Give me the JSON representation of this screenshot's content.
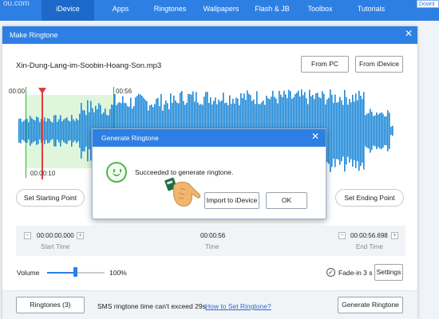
{
  "topnav": {
    "brand_fragment": "ou.com",
    "tabs": [
      {
        "label": "iDevice",
        "active": true
      },
      {
        "label": "Apps",
        "active": false
      },
      {
        "label": "Ringtones",
        "active": false
      },
      {
        "label": "Wallpapers",
        "active": false
      },
      {
        "label": "Flash & JB",
        "active": false
      },
      {
        "label": "Toolbox",
        "active": false
      },
      {
        "label": "Tutorials",
        "active": false
      }
    ],
    "download_label": "Downl",
    "accent_color": "#2d7fe3"
  },
  "window": {
    "title": "Make Ringtone",
    "close_icon": "close-icon",
    "file_name": "Xin-Dung-Lang-im-Soobin-Hoang-Son.mp3",
    "from_pc_label": "From PC",
    "from_idevice_label": "From iDevice",
    "waveform": {
      "time_start": "00:00",
      "time_end_marker": "00:56",
      "playhead_time": "00:00:10",
      "wave_color": "#1e88d8",
      "selection_color": "#dff6dc"
    },
    "set_starting_point_label": "Set Starting Point",
    "set_ending_point_label": "Set Ending Point",
    "start_time": {
      "value": "00:00:00.000",
      "label": "Start Time"
    },
    "time": {
      "value": "00:00:56",
      "label": "Time"
    },
    "end_time": {
      "value": "00:00:56.698",
      "label": "End Time"
    },
    "volume": {
      "label": "Volume",
      "value_text": "100%",
      "level": 0.5
    },
    "fade": {
      "label": "Fade-in 3 s",
      "checked": true
    },
    "settings_label": "Settings",
    "ringtones_label": "Ringtones (3)",
    "sms_info": "SMS ringtone time can't exceed 29s.",
    "how_to_link": "How to Set Ringtone?",
    "generate_label": "Generate Ringtone"
  },
  "dialog": {
    "title": "Generate Ringtone",
    "message": "Succeeded to generate ringtone.",
    "icon": "smiley-icon",
    "import_label": "Import to iDevice",
    "ok_label": "OK"
  },
  "overlay": {
    "icon": "pointing-hand-icon"
  }
}
